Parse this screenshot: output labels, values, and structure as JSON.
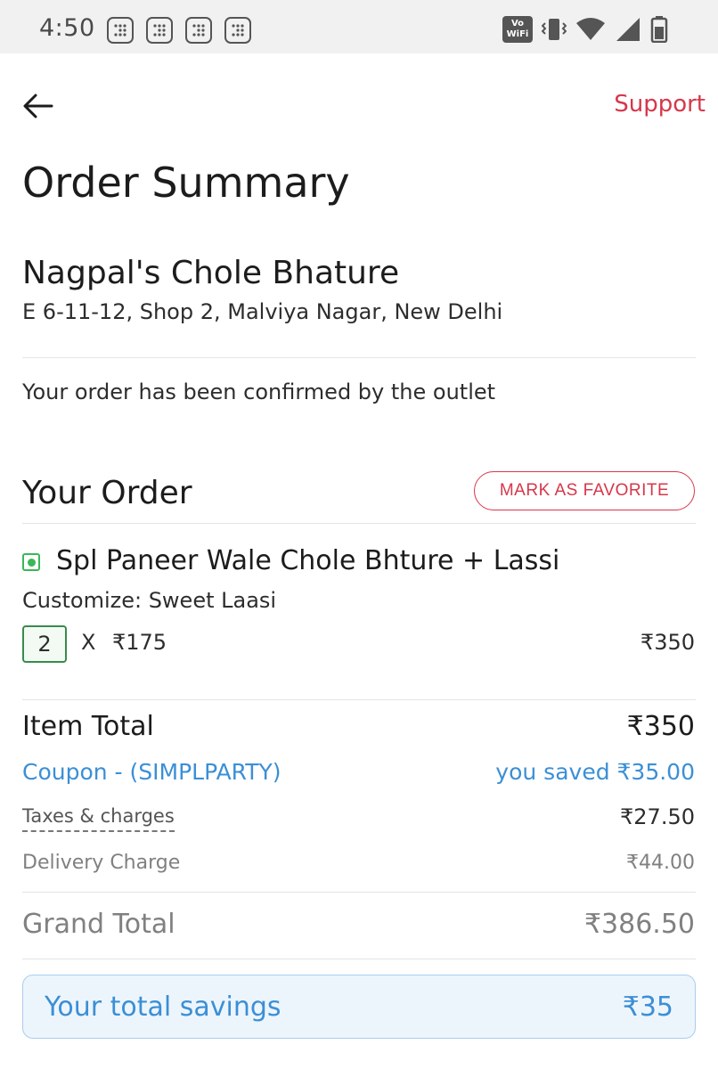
{
  "status_bar": {
    "time": "4:50",
    "notification_icons": [
      "grid-notification-icon",
      "grid-notification-icon",
      "grid-notification-icon",
      "grid-notification-icon"
    ],
    "vowifi_line1": "Vo",
    "vowifi_line2": "WiFi",
    "system_icons": [
      "vibrate-icon",
      "wifi-icon",
      "signal-icon",
      "battery-icon"
    ]
  },
  "header": {
    "back_icon": "arrow-left-icon",
    "support_label": "Support"
  },
  "page": {
    "title": "Order Summary"
  },
  "restaurant": {
    "name": "Nagpal's Chole Bhature",
    "address": "E 6-11-12, Shop 2, Malviya Nagar, New Delhi"
  },
  "order_status": "Your order has been confirmed by the outlet",
  "your_order": {
    "heading": "Your Order",
    "favorite_button": "MARK AS FAVORITE",
    "items": [
      {
        "name": "Spl Paneer Wale Chole Bhture + Lassi",
        "veg": true,
        "customize": "Customize: Sweet Laasi",
        "quantity": "2",
        "times": "X",
        "unit_price": "₹175",
        "total": "₹350"
      }
    ]
  },
  "bill": {
    "item_total_label": "Item Total",
    "item_total_value": "₹350",
    "coupon_label": "Coupon - (SIMPLPARTY)",
    "coupon_value": "you saved ₹35.00",
    "taxes_label": "Taxes & charges",
    "taxes_value": "₹27.50",
    "delivery_label": "Delivery Charge",
    "delivery_value": "₹44.00",
    "grand_total_label": "Grand Total",
    "grand_total_value": "₹386.50"
  },
  "savings": {
    "label": "Your total savings",
    "value": "₹35"
  },
  "colors": {
    "accent_red": "#d6374a",
    "coupon_blue": "#3b8fd6",
    "veg_green": "#3ab757",
    "savings_bg": "#edf5fc"
  }
}
